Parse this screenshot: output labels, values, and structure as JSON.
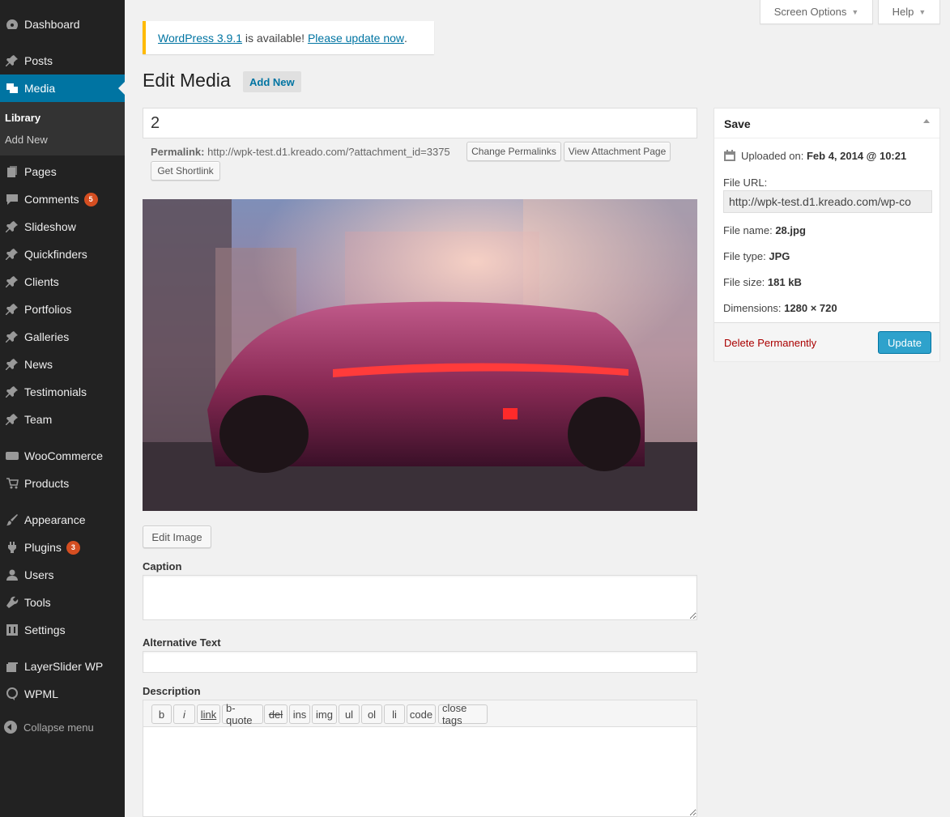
{
  "sidebar": {
    "items": [
      {
        "label": "Dashboard",
        "icon": "dashboard-icon"
      },
      {
        "label": "Posts",
        "icon": "pin-icon"
      },
      {
        "label": "Media",
        "icon": "media-icon"
      },
      {
        "label": "Pages",
        "icon": "pages-icon"
      },
      {
        "label": "Comments",
        "icon": "comment-icon",
        "badge": "5"
      },
      {
        "label": "Slideshow",
        "icon": "pin-icon"
      },
      {
        "label": "Quickfinders",
        "icon": "pin-icon"
      },
      {
        "label": "Clients",
        "icon": "pin-icon"
      },
      {
        "label": "Portfolios",
        "icon": "pin-icon"
      },
      {
        "label": "Galleries",
        "icon": "pin-icon"
      },
      {
        "label": "News",
        "icon": "pin-icon"
      },
      {
        "label": "Testimonials",
        "icon": "pin-icon"
      },
      {
        "label": "Team",
        "icon": "pin-icon"
      },
      {
        "label": "WooCommerce",
        "icon": "woocommerce-icon"
      },
      {
        "label": "Products",
        "icon": "cart-icon"
      },
      {
        "label": "Appearance",
        "icon": "brush-icon"
      },
      {
        "label": "Plugins",
        "icon": "plugin-icon",
        "badge": "3"
      },
      {
        "label": "Users",
        "icon": "user-icon"
      },
      {
        "label": "Tools",
        "icon": "wrench-icon"
      },
      {
        "label": "Settings",
        "icon": "settings-icon"
      },
      {
        "label": "LayerSlider WP",
        "icon": "layers-icon"
      },
      {
        "label": "WPML",
        "icon": "wpml-icon"
      }
    ],
    "submenu": {
      "library": "Library",
      "add_new": "Add New"
    },
    "collapse": "Collapse menu"
  },
  "top": {
    "screen_options": "Screen Options",
    "help": "Help"
  },
  "notice": {
    "version_link": "WordPress 3.9.1",
    "text": " is available! ",
    "update_link": "Please update now",
    "end": "."
  },
  "page": {
    "title": "Edit Media",
    "add_new": "Add New"
  },
  "post_title": "2",
  "permalink": {
    "label": "Permalink:",
    "url": "http://wpk-test.d1.kreado.com/?attachment_id=3375",
    "change": "Change Permalinks",
    "view": "View Attachment Page",
    "shortlink": "Get Shortlink"
  },
  "edit_image": "Edit Image",
  "fields": {
    "caption": "Caption",
    "alt": "Alternative Text",
    "description": "Description"
  },
  "quicktags": [
    "b",
    "i",
    "link",
    "b-quote",
    "del",
    "ins",
    "img",
    "ul",
    "ol",
    "li",
    "code",
    "close tags"
  ],
  "save": {
    "title": "Save",
    "uploaded_label": "Uploaded on:",
    "uploaded_value": "Feb 4, 2014 @ 10:21",
    "file_url_label": "File URL:",
    "file_url_value": "http://wpk-test.d1.kreado.com/wp-co",
    "file_name_label": "File name:",
    "file_name_value": "28.jpg",
    "file_type_label": "File type:",
    "file_type_value": "JPG",
    "file_size_label": "File size:",
    "file_size_value": "181 kB",
    "dimensions_label": "Dimensions:",
    "dimensions_value": "1280 × 720",
    "delete": "Delete Permanently",
    "update": "Update"
  },
  "colors": {
    "sidebar": "#222222",
    "active": "#0074a2",
    "notice_border": "#ffba00",
    "update_button": "#2ea2cc",
    "delete_link": "#aa0000"
  }
}
